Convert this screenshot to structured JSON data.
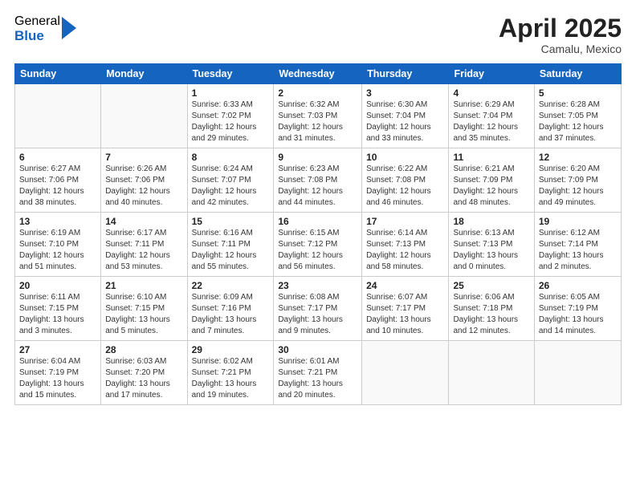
{
  "header": {
    "logo_general": "General",
    "logo_blue": "Blue",
    "month_title": "April 2025",
    "location": "Camalu, Mexico"
  },
  "days_of_week": [
    "Sunday",
    "Monday",
    "Tuesday",
    "Wednesday",
    "Thursday",
    "Friday",
    "Saturday"
  ],
  "weeks": [
    [
      {
        "day": "",
        "info": ""
      },
      {
        "day": "",
        "info": ""
      },
      {
        "day": "1",
        "info": "Sunrise: 6:33 AM\nSunset: 7:02 PM\nDaylight: 12 hours\nand 29 minutes."
      },
      {
        "day": "2",
        "info": "Sunrise: 6:32 AM\nSunset: 7:03 PM\nDaylight: 12 hours\nand 31 minutes."
      },
      {
        "day": "3",
        "info": "Sunrise: 6:30 AM\nSunset: 7:04 PM\nDaylight: 12 hours\nand 33 minutes."
      },
      {
        "day": "4",
        "info": "Sunrise: 6:29 AM\nSunset: 7:04 PM\nDaylight: 12 hours\nand 35 minutes."
      },
      {
        "day": "5",
        "info": "Sunrise: 6:28 AM\nSunset: 7:05 PM\nDaylight: 12 hours\nand 37 minutes."
      }
    ],
    [
      {
        "day": "6",
        "info": "Sunrise: 6:27 AM\nSunset: 7:06 PM\nDaylight: 12 hours\nand 38 minutes."
      },
      {
        "day": "7",
        "info": "Sunrise: 6:26 AM\nSunset: 7:06 PM\nDaylight: 12 hours\nand 40 minutes."
      },
      {
        "day": "8",
        "info": "Sunrise: 6:24 AM\nSunset: 7:07 PM\nDaylight: 12 hours\nand 42 minutes."
      },
      {
        "day": "9",
        "info": "Sunrise: 6:23 AM\nSunset: 7:08 PM\nDaylight: 12 hours\nand 44 minutes."
      },
      {
        "day": "10",
        "info": "Sunrise: 6:22 AM\nSunset: 7:08 PM\nDaylight: 12 hours\nand 46 minutes."
      },
      {
        "day": "11",
        "info": "Sunrise: 6:21 AM\nSunset: 7:09 PM\nDaylight: 12 hours\nand 48 minutes."
      },
      {
        "day": "12",
        "info": "Sunrise: 6:20 AM\nSunset: 7:09 PM\nDaylight: 12 hours\nand 49 minutes."
      }
    ],
    [
      {
        "day": "13",
        "info": "Sunrise: 6:19 AM\nSunset: 7:10 PM\nDaylight: 12 hours\nand 51 minutes."
      },
      {
        "day": "14",
        "info": "Sunrise: 6:17 AM\nSunset: 7:11 PM\nDaylight: 12 hours\nand 53 minutes."
      },
      {
        "day": "15",
        "info": "Sunrise: 6:16 AM\nSunset: 7:11 PM\nDaylight: 12 hours\nand 55 minutes."
      },
      {
        "day": "16",
        "info": "Sunrise: 6:15 AM\nSunset: 7:12 PM\nDaylight: 12 hours\nand 56 minutes."
      },
      {
        "day": "17",
        "info": "Sunrise: 6:14 AM\nSunset: 7:13 PM\nDaylight: 12 hours\nand 58 minutes."
      },
      {
        "day": "18",
        "info": "Sunrise: 6:13 AM\nSunset: 7:13 PM\nDaylight: 13 hours\nand 0 minutes."
      },
      {
        "day": "19",
        "info": "Sunrise: 6:12 AM\nSunset: 7:14 PM\nDaylight: 13 hours\nand 2 minutes."
      }
    ],
    [
      {
        "day": "20",
        "info": "Sunrise: 6:11 AM\nSunset: 7:15 PM\nDaylight: 13 hours\nand 3 minutes."
      },
      {
        "day": "21",
        "info": "Sunrise: 6:10 AM\nSunset: 7:15 PM\nDaylight: 13 hours\nand 5 minutes."
      },
      {
        "day": "22",
        "info": "Sunrise: 6:09 AM\nSunset: 7:16 PM\nDaylight: 13 hours\nand 7 minutes."
      },
      {
        "day": "23",
        "info": "Sunrise: 6:08 AM\nSunset: 7:17 PM\nDaylight: 13 hours\nand 9 minutes."
      },
      {
        "day": "24",
        "info": "Sunrise: 6:07 AM\nSunset: 7:17 PM\nDaylight: 13 hours\nand 10 minutes."
      },
      {
        "day": "25",
        "info": "Sunrise: 6:06 AM\nSunset: 7:18 PM\nDaylight: 13 hours\nand 12 minutes."
      },
      {
        "day": "26",
        "info": "Sunrise: 6:05 AM\nSunset: 7:19 PM\nDaylight: 13 hours\nand 14 minutes."
      }
    ],
    [
      {
        "day": "27",
        "info": "Sunrise: 6:04 AM\nSunset: 7:19 PM\nDaylight: 13 hours\nand 15 minutes."
      },
      {
        "day": "28",
        "info": "Sunrise: 6:03 AM\nSunset: 7:20 PM\nDaylight: 13 hours\nand 17 minutes."
      },
      {
        "day": "29",
        "info": "Sunrise: 6:02 AM\nSunset: 7:21 PM\nDaylight: 13 hours\nand 19 minutes."
      },
      {
        "day": "30",
        "info": "Sunrise: 6:01 AM\nSunset: 7:21 PM\nDaylight: 13 hours\nand 20 minutes."
      },
      {
        "day": "",
        "info": ""
      },
      {
        "day": "",
        "info": ""
      },
      {
        "day": "",
        "info": ""
      }
    ]
  ]
}
